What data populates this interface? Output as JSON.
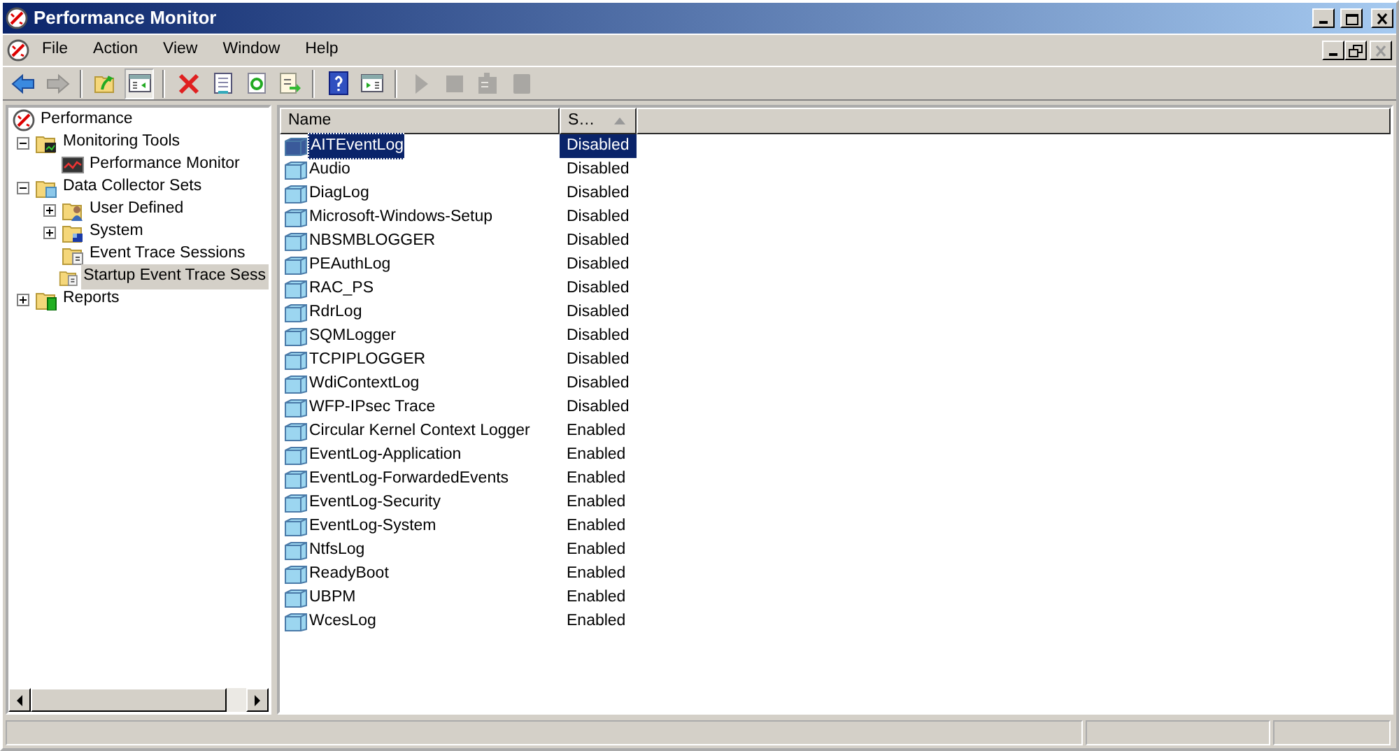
{
  "window": {
    "title": "Performance Monitor"
  },
  "menu": [
    "File",
    "Action",
    "View",
    "Window",
    "Help"
  ],
  "toolbar": [
    {
      "kind": "back",
      "disabled": false,
      "pressed": false
    },
    {
      "kind": "forward",
      "disabled": true,
      "pressed": false
    },
    {
      "kind": "separator"
    },
    {
      "kind": "up",
      "disabled": false,
      "pressed": false
    },
    {
      "kind": "console-tree",
      "disabled": false,
      "pressed": true
    },
    {
      "kind": "separator"
    },
    {
      "kind": "delete",
      "disabled": false,
      "pressed": false
    },
    {
      "kind": "properties",
      "disabled": false,
      "pressed": false
    },
    {
      "kind": "refresh",
      "disabled": false,
      "pressed": false
    },
    {
      "kind": "export",
      "disabled": false,
      "pressed": false
    },
    {
      "kind": "separator"
    },
    {
      "kind": "help",
      "disabled": false,
      "pressed": false
    },
    {
      "kind": "action-pane",
      "disabled": false,
      "pressed": false
    },
    {
      "kind": "separator"
    },
    {
      "kind": "start",
      "disabled": true,
      "pressed": false
    },
    {
      "kind": "stop",
      "disabled": true,
      "pressed": false
    },
    {
      "kind": "save-template",
      "disabled": true,
      "pressed": false
    },
    {
      "kind": "square",
      "disabled": true,
      "pressed": false
    }
  ],
  "tree": [
    {
      "label": "Performance",
      "kind": "gauge",
      "selected": false,
      "children": [
        {
          "label": "Monitoring Tools",
          "kind": "folder-chart",
          "expanded": true,
          "selected": false,
          "children": [
            {
              "label": "Performance Monitor",
              "kind": "chart",
              "selected": false
            }
          ]
        },
        {
          "label": "Data Collector Sets",
          "kind": "folder-data",
          "expanded": true,
          "selected": false,
          "children": [
            {
              "label": "User Defined",
              "kind": "folder-user",
              "expanded": false,
              "selected": false
            },
            {
              "label": "System",
              "kind": "folder-system",
              "expanded": false,
              "selected": false
            },
            {
              "label": "Event Trace Sessions",
              "kind": "folder-doc",
              "selected": false
            },
            {
              "label": "Startup Event Trace Sess",
              "kind": "folder-doc",
              "selected": true
            }
          ]
        },
        {
          "label": "Reports",
          "kind": "folder-report",
          "expanded": false,
          "selected": false
        }
      ]
    }
  ],
  "list": {
    "columns": [
      "Name",
      "S…"
    ],
    "rows": [
      {
        "name": "AITEventLog",
        "status": "Disabled",
        "selected": true
      },
      {
        "name": "Audio",
        "status": "Disabled",
        "selected": false
      },
      {
        "name": "DiagLog",
        "status": "Disabled",
        "selected": false
      },
      {
        "name": "Microsoft-Windows-Setup",
        "status": "Disabled",
        "selected": false
      },
      {
        "name": "NBSMBLOGGER",
        "status": "Disabled",
        "selected": false
      },
      {
        "name": "PEAuthLog",
        "status": "Disabled",
        "selected": false
      },
      {
        "name": "RAC_PS",
        "status": "Disabled",
        "selected": false
      },
      {
        "name": "RdrLog",
        "status": "Disabled",
        "selected": false
      },
      {
        "name": "SQMLogger",
        "status": "Disabled",
        "selected": false
      },
      {
        "name": "TCPIPLOGGER",
        "status": "Disabled",
        "selected": false
      },
      {
        "name": "WdiContextLog",
        "status": "Disabled",
        "selected": false
      },
      {
        "name": "WFP-IPsec Trace",
        "status": "Disabled",
        "selected": false
      },
      {
        "name": "Circular Kernel Context Logger",
        "status": "Enabled",
        "selected": false
      },
      {
        "name": "EventLog-Application",
        "status": "Enabled",
        "selected": false
      },
      {
        "name": "EventLog-ForwardedEvents",
        "status": "Enabled",
        "selected": false
      },
      {
        "name": "EventLog-Security",
        "status": "Enabled",
        "selected": false
      },
      {
        "name": "EventLog-System",
        "status": "Enabled",
        "selected": false
      },
      {
        "name": "NtfsLog",
        "status": "Enabled",
        "selected": false
      },
      {
        "name": "ReadyBoot",
        "status": "Enabled",
        "selected": false
      },
      {
        "name": "UBPM",
        "status": "Enabled",
        "selected": false
      },
      {
        "name": "WcesLog",
        "status": "Enabled",
        "selected": false
      }
    ]
  }
}
